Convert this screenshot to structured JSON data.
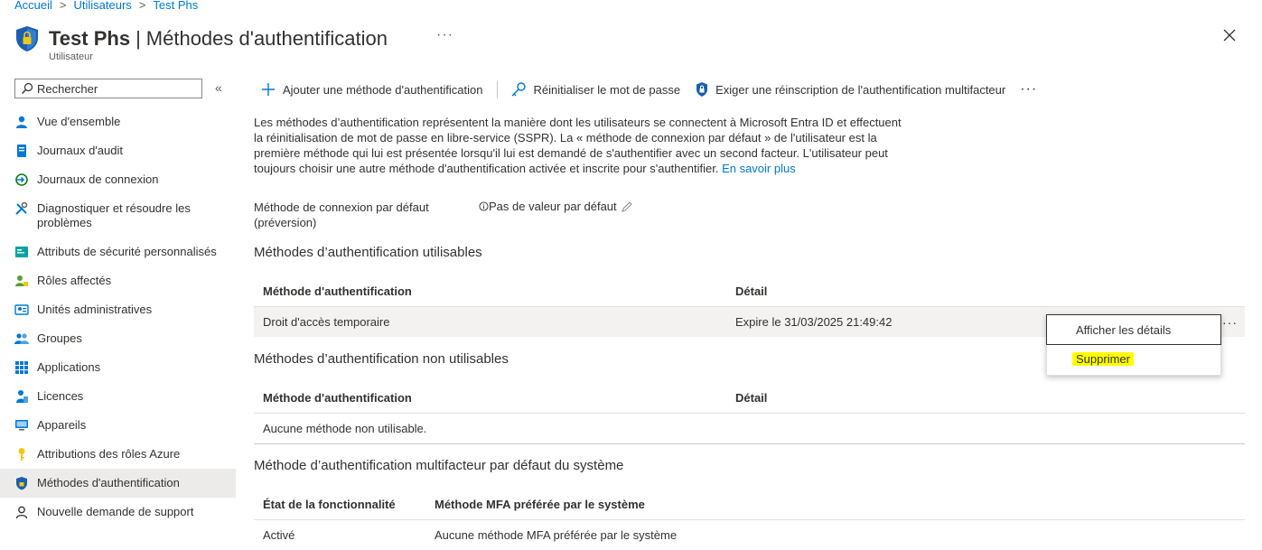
{
  "breadcrumb": [
    "Accueil",
    "Utilisateurs",
    "Test Phs"
  ],
  "header": {
    "title_bold": "Test Phs",
    "title_sep": "|",
    "title_rest": "Méthodes d'authentification",
    "more": "···",
    "subtitle": "Utilisateur"
  },
  "sidebar": {
    "search_placeholder": "Rechercher",
    "collapse": "«",
    "items": [
      {
        "label": "Vue d'ensemble"
      },
      {
        "label": "Journaux d'audit"
      },
      {
        "label": "Journaux de connexion"
      },
      {
        "label": "Diagnostiquer et résoudre les problèmes"
      },
      {
        "label": "Attributs de sécurité personnalisés"
      },
      {
        "label": "Rôles affectés"
      },
      {
        "label": "Unités administratives"
      },
      {
        "label": "Groupes"
      },
      {
        "label": "Applications"
      },
      {
        "label": "Licences"
      },
      {
        "label": "Appareils"
      },
      {
        "label": "Attributions des rôles Azure"
      },
      {
        "label": "Méthodes d'authentification"
      },
      {
        "label": "Nouvelle demande de support"
      }
    ]
  },
  "toolbar": {
    "add": "Ajouter une méthode d'authentification",
    "reset": "Réinitialiser le mot de passe",
    "require": "Exiger une réinscription de l'authentification multifacteur",
    "more": "···"
  },
  "description": {
    "text": "Les méthodes d’authentification représentent la manière dont les utilisateurs se connectent à Microsoft Entra ID et effectuent la réinitialisation de mot de passe en libre-service (SSPR). La « méthode de connexion par défaut » de l'utilisateur est la première méthode qui lui est présentée lorsqu'il lui est demandé de s'authentifier avec un second facteur. L'utilisateur peut toujours choisir une autre méthode d'authentification activée et inscrite pour s'authentifier.",
    "link": "En savoir plus"
  },
  "default_method": {
    "label": "Méthode de connexion par défaut (préversion)",
    "value": "Pas de valeur par défaut"
  },
  "usable": {
    "heading": "Méthodes d’authentification utilisables",
    "col1": "Méthode d'authentification",
    "col2": "Détail",
    "rows": [
      {
        "method": "Droit d'accès temporaire",
        "detail": "Expire le 31/03/2025 21:49:42"
      }
    ],
    "row_more": "···"
  },
  "context_menu": {
    "details": "Afficher les détails",
    "delete": "Supprimer"
  },
  "unusable": {
    "heading": "Méthodes d’authentification non utilisables",
    "col1": "Méthode d'authentification",
    "col2": "Détail",
    "empty": "Aucune méthode non utilisable."
  },
  "mfa": {
    "heading": "Méthode d’authentification multifacteur par défaut du système",
    "col1": "État de la fonctionnalité",
    "col2": "Méthode MFA préférée par le système",
    "state": "Activé",
    "method": "Aucune méthode MFA préférée par le système"
  },
  "colors": {
    "accent": "#0078d4",
    "highlight": "#ffff00",
    "selected_row": "#f3f2f1",
    "active_nav": "#edebe9"
  }
}
